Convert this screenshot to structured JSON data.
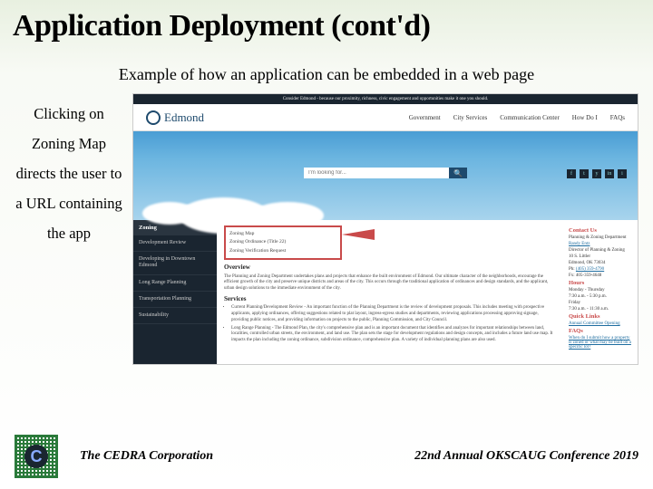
{
  "title": "Application Deployment (cont'd)",
  "subtitle": "Example of how an application can be embedded in a web page",
  "sideText": "Clicking on Zoning Map directs the user to a URL containing the app",
  "screenshot": {
    "banner": "Consider Edmond - because our proximity, richness, civic engagement and opportunities make it one you should.",
    "logoText": "Edmond",
    "nav": [
      "Government",
      "City Services",
      "Communication Center",
      "How Do I",
      "FAQs"
    ],
    "searchPlaceholder": "I'm looking for...",
    "social": [
      "f",
      "t",
      "y",
      "in",
      "i"
    ],
    "sidebar": {
      "header": "Zoning",
      "items": [
        "Development Review",
        "Developing in Downtown Edmond",
        "Long Range Planning",
        "Transportation Planning",
        "Sustainability"
      ]
    },
    "dropdown": [
      "Zoning Map",
      "Zoning Ordinance (Title 22)",
      "Zoning Verification Request"
    ],
    "main": {
      "h1": "Overview",
      "p1": "The Planning and Zoning Department undertakes plans and projects that enhance the built environment of Edmond. Our ultimate character of the neighborhoods, encourage the efficient growth of the city and preserve unique districts and areas of the city. This occurs through the traditional application of ordinances and design standards, and the applicant, urban design solutions to the immediate environment of the city.",
      "h2": "Services",
      "items": [
        "Current Planning/Development Review - An important function of the Planning Department is the review of development proposals. This includes meeting with prospective applicants, applying ordinances, offering suggestions related to plat layout, ingress-egress studies and departments, reviewing applications processing approving signage, providing public notices, and providing information on projects to the public, Planning Commission, and City Council.",
        "Long Range Planning - The Edmond Plan, the city's comprehensive plan and is an important document that identifies and analyzes for important relationships between land, localities, controlled urban streets, the environment, and land use. The plan sets the stage for development regulations and design concepts, and includes a future land use map. It impacts the plan including the zoning ordinance, subdivision ordinance, comprehensive plan. A variety of individual planning plans are also used."
      ]
    },
    "right": {
      "contactHeader": "Contact Us",
      "dept": "Planning & Zoning Department",
      "name": "Randy Entz",
      "title2": "Director of Planning & Zoning",
      "addr1": "10 S. Littler",
      "addr2": "Edmond, OK 73034",
      "phLabel": "Ph:",
      "phone": "(405) 359-4790",
      "fxLabel": "Fx:",
      "fax": "405-359-4648",
      "hoursHeader": "Hours",
      "hours1": "Monday - Thursday",
      "hours2": "7:30 a.m. - 5:30 p.m.",
      "hours3": "Friday",
      "hours4": "7:30 a.m. - 11:30 a.m.",
      "quickHeader": "Quick Links",
      "quickLink": "Annual Committee Opening",
      "faqHeader": "FAQs",
      "faq1": "When do I submit how a property is zoned or what may be built on a specific lot?"
    }
  },
  "footer": {
    "left": "The CEDRA Corporation",
    "right": "22nd Annual OKSCAUG Conference 2019"
  }
}
